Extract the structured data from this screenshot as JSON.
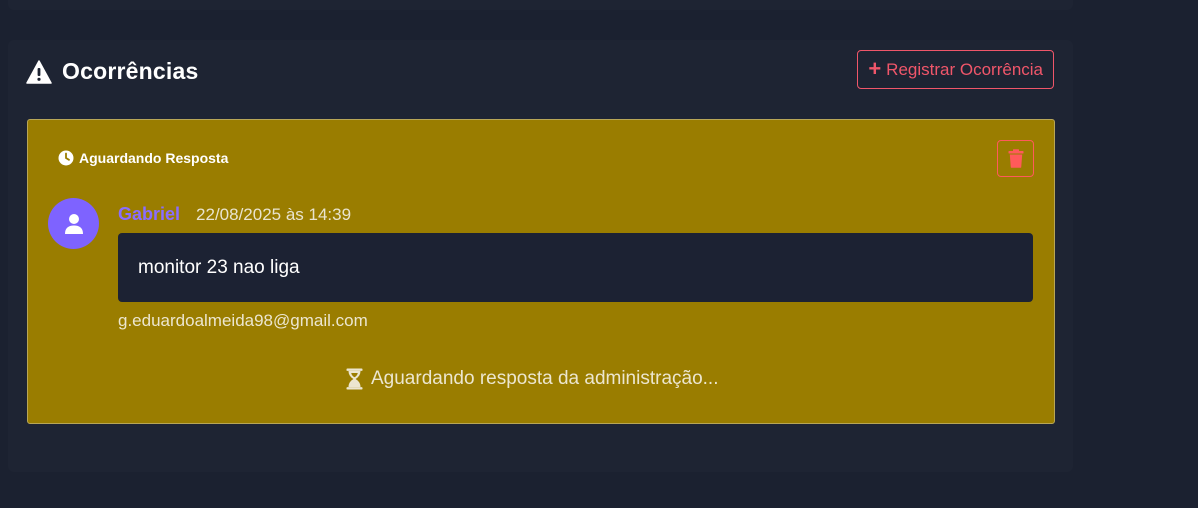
{
  "section": {
    "title": "Ocorrências",
    "title_icon": "warning-triangle-icon",
    "register_button": {
      "icon": "plus-icon",
      "label": "Registrar Ocorrência"
    }
  },
  "occurrence": {
    "status_icon": "clock-icon",
    "status": "Aguardando Resposta",
    "delete_icon": "trash-icon",
    "author": "Gabriel",
    "datetime": "22/08/2025 às 14:39",
    "message": "monitor 23 nao liga",
    "email": "g.eduardoalmeida98@gmail.com",
    "waiting_icon": "hourglass-icon",
    "waiting_text": "Aguardando resposta da administração..."
  },
  "colors": {
    "background": "#1b2130",
    "panel": "#1e2433",
    "card_pending": "#9a7d00",
    "accent_red": "#f0566a",
    "avatar": "#7e63ff",
    "author": "#8a6dff"
  }
}
